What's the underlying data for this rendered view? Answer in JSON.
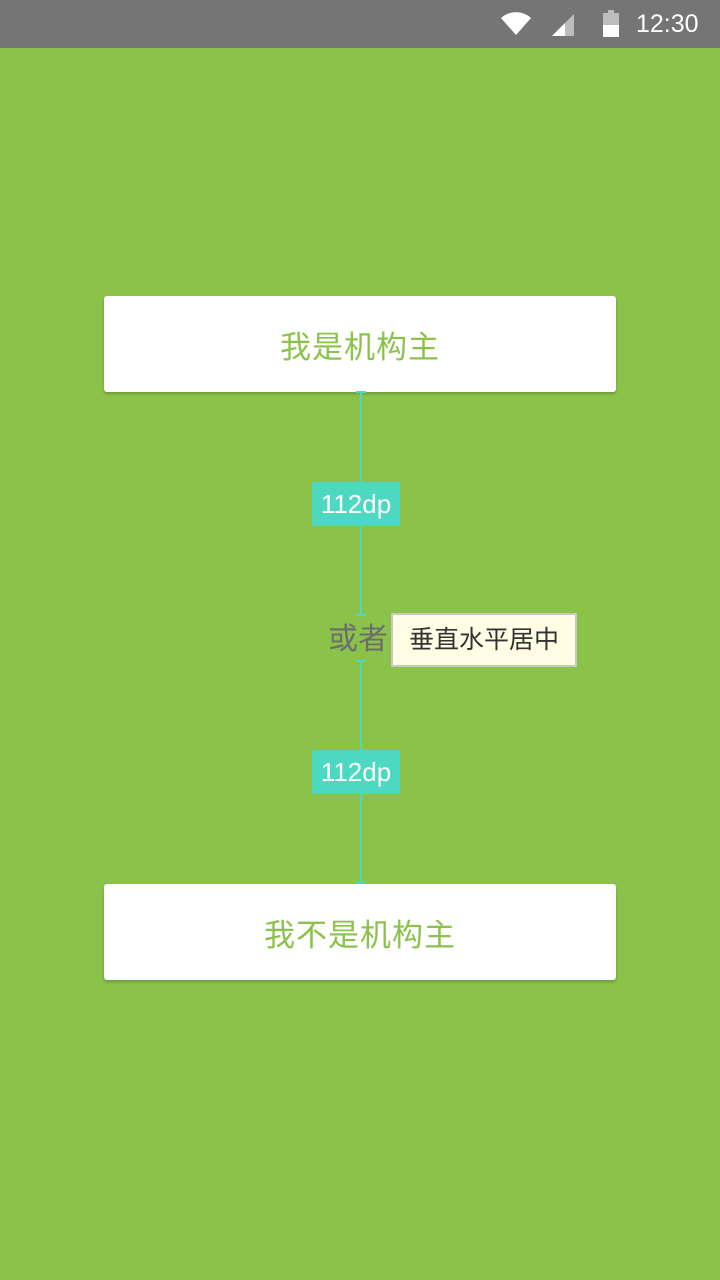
{
  "status_bar": {
    "time": "12:30",
    "icons": [
      "wifi-icon",
      "cell-signal-icon",
      "battery-icon"
    ]
  },
  "buttons": {
    "organizer": "我是机构主",
    "not_organizer": "我不是机构主"
  },
  "separator": {
    "text": "或者"
  },
  "annotations": {
    "spacing_top": "112dp",
    "spacing_bottom": "112dp",
    "center_note": "垂直水平居中"
  },
  "colors": {
    "background": "#8bc34a",
    "button_text": "#8bc34a",
    "button_background": "#ffffff",
    "guide": "#4dd9c1",
    "status_bar": "#757575"
  }
}
